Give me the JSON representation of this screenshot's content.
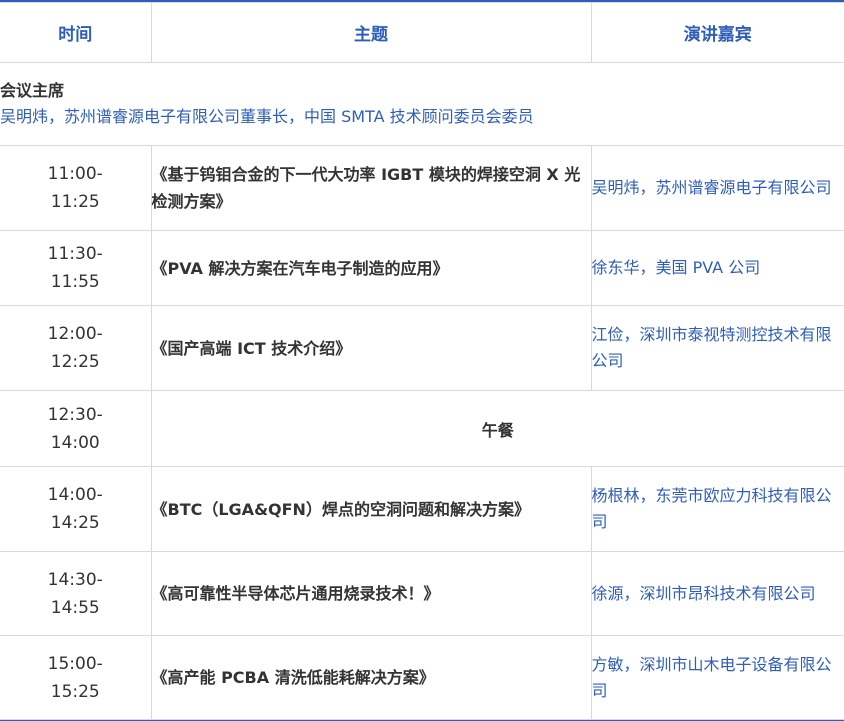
{
  "header": {
    "time": "时间",
    "topic": "主题",
    "speaker": "演讲嘉宾"
  },
  "chair": {
    "title": "会议主席",
    "name": "吴明炜，苏州谱睿源电子有限公司董事长，中国 SMTA 技术顾问委员会委员"
  },
  "sessions": [
    {
      "start": "11:00-",
      "end": "11:25",
      "topic": "《基于钨钼合金的下一代大功率 IGBT 模块的焊接空洞 X 光检测方案》",
      "speaker": "吴明炜，苏州谱睿源电子有限公司"
    },
    {
      "start": "11:30-",
      "end": "11:55",
      "topic": "《PVA 解决方案在汽车电子制造的应用》",
      "speaker": "徐东华，美国 PVA 公司"
    },
    {
      "start": "12:00-",
      "end": "12:25",
      "topic": "《国产高端 ICT 技术介绍》",
      "speaker": "江俭，深圳市泰视特测控技术有限公司"
    },
    {
      "start": "12:30-",
      "end": "14:00",
      "topic": "午餐",
      "speaker": ""
    },
    {
      "start": "14:00-",
      "end": "14:25",
      "topic": "《BTC（LGA&QFN）焊点的空洞问题和解决方案》",
      "speaker": "杨根林，东莞市欧应力科技有限公司"
    },
    {
      "start": "14:30-",
      "end": "14:55",
      "topic": "《高可靠性半导体芯片通用烧录技术！》",
      "speaker": "徐源，深圳市昂科技术有限公司"
    },
    {
      "start": "15:00-",
      "end": "15:25",
      "topic": "《高产能 PCBA 清洗低能耗解决方案》",
      "speaker": "方敏，深圳市山木电子设备有限公司"
    }
  ]
}
